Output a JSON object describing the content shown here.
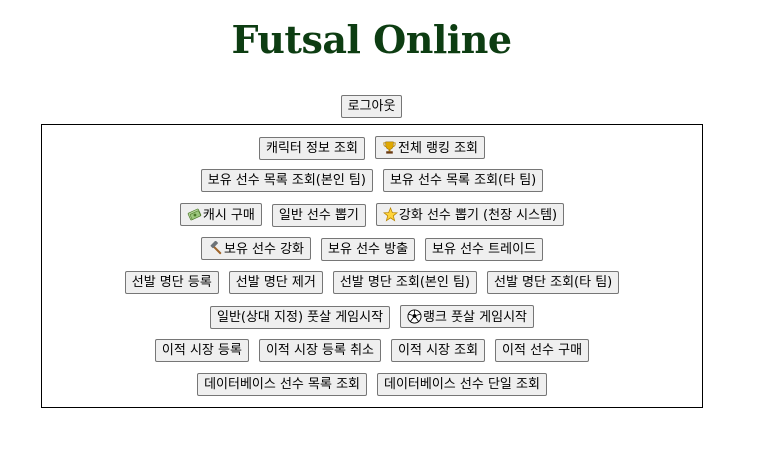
{
  "header": {
    "title": "Futsal Online"
  },
  "logout": {
    "label": "로그아웃"
  },
  "menu": {
    "rows": [
      [
        {
          "label": "캐릭터 정보 조회",
          "icon": null
        },
        {
          "label": "전체 랭킹 조회",
          "icon": "trophy-icon"
        }
      ],
      [
        {
          "label": "보유 선수 목록 조회(본인 팀)",
          "icon": null
        },
        {
          "label": "보유 선수 목록 조회(타 팀)",
          "icon": null
        }
      ],
      [
        {
          "label": "캐시 구매",
          "icon": "money-icon"
        },
        {
          "label": "일반 선수 뽑기",
          "icon": null
        },
        {
          "label": "강화 선수 뽑기 (천장 시스템)",
          "icon": "star-icon"
        }
      ],
      [
        {
          "label": "보유 선수 강화",
          "icon": "hammer-icon"
        },
        {
          "label": "보유 선수 방출",
          "icon": null
        },
        {
          "label": "보유 선수 트레이드",
          "icon": null
        }
      ],
      [
        {
          "label": "선발 명단 등록",
          "icon": null
        },
        {
          "label": "선발 명단 제거",
          "icon": null
        },
        {
          "label": "선발 명단 조회(본인 팀)",
          "icon": null
        },
        {
          "label": "선발 명단 조회(타 팀)",
          "icon": null
        }
      ],
      [
        {
          "label": "일반(상대 지정) 풋살 게임시작",
          "icon": null
        },
        {
          "label": "랭크 풋살 게임시작",
          "icon": "soccer-ball-icon"
        }
      ],
      [
        {
          "label": "이적 시장 등록",
          "icon": null
        },
        {
          "label": "이적 시장 등록 취소",
          "icon": null
        },
        {
          "label": "이적 시장 조회",
          "icon": null
        },
        {
          "label": "이적 선수 구매",
          "icon": null
        }
      ],
      [
        {
          "label": "데이터베이스 선수 목록 조회",
          "icon": null
        },
        {
          "label": "데이터베이스 선수 단일 조회",
          "icon": null
        }
      ]
    ]
  }
}
